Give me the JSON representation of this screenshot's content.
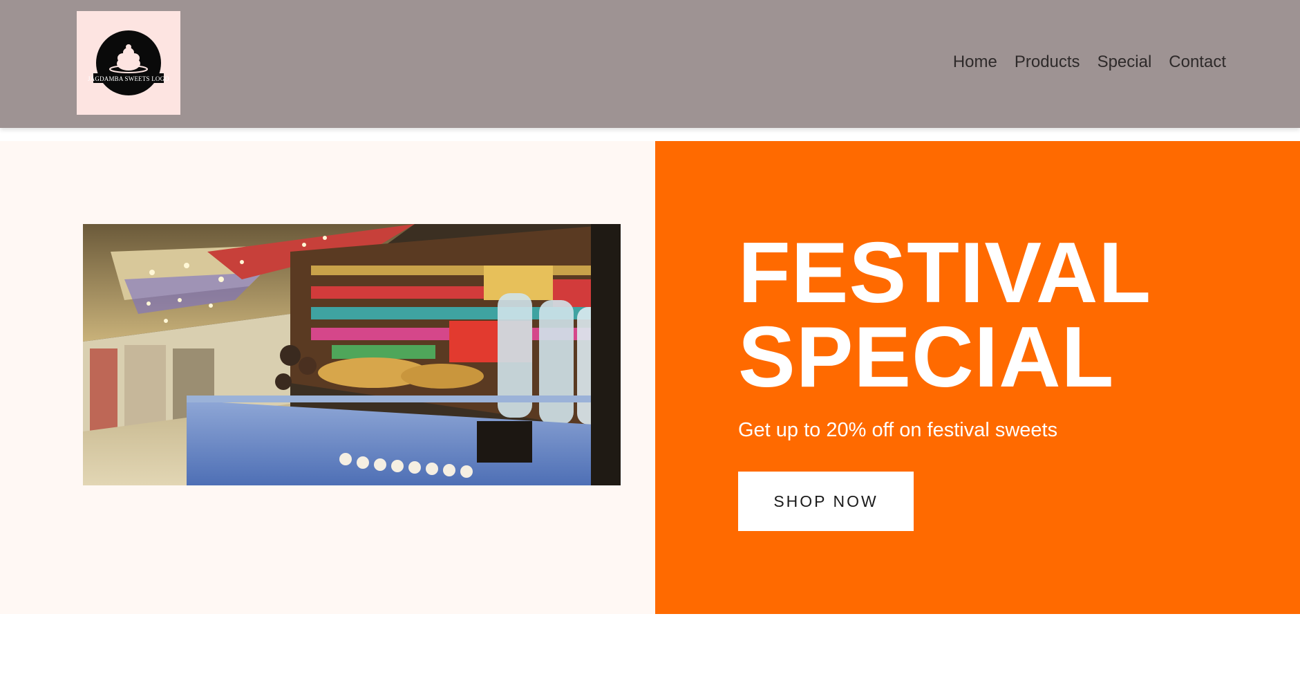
{
  "header": {
    "logo_text": "JAGDAMBA SWEETS LOGO",
    "background": "#9e9393"
  },
  "nav": {
    "items": [
      {
        "label": "Home"
      },
      {
        "label": "Products"
      },
      {
        "label": "Special"
      },
      {
        "label": "Contact"
      }
    ]
  },
  "hero": {
    "image_icon": "sweet-shop-interior-photo",
    "title_line1": "FESTIVAL",
    "title_line2": "SPECIAL",
    "subtitle": "Get up to 20% off on festival sweets",
    "cta_label": "SHOP NOW",
    "accent_color": "#ff6a00",
    "left_background": "#fff8f4"
  }
}
